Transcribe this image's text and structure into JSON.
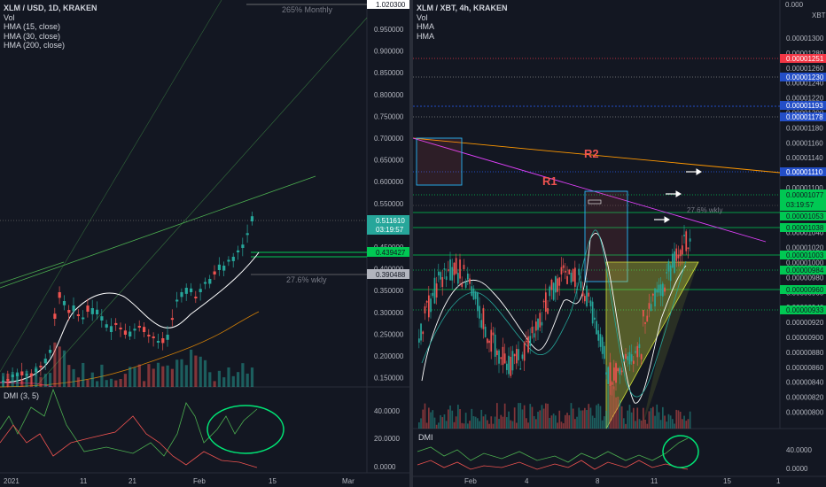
{
  "left": {
    "title": "XLM / USD, 1D, KRAKEN",
    "legend": [
      "Vol",
      "HMA (15, close)",
      "HMA (30, close)",
      "HMA (200, close)"
    ],
    "price_axis": [
      "0.950000",
      "0.900000",
      "0.850000",
      "0.800000",
      "0.750000",
      "0.700000",
      "0.650000",
      "0.600000",
      "0.550000",
      "0.500000",
      "0.450000",
      "0.400000",
      "0.350000",
      "0.300000",
      "0.250000",
      "0.200000",
      "0.150000"
    ],
    "tags": {
      "top": "1.020300",
      "last": "0.511610",
      "countdown": "03:19:57",
      "green": "0.439427",
      "grey": "0.390488"
    },
    "annotations": {
      "monthly": "265% Monthly",
      "weekly": "27.6% wkly"
    },
    "dmi": {
      "label": "DMI (3, 5)",
      "axis": [
        "40.0000",
        "20.0000",
        "0.0000"
      ]
    },
    "time_axis": [
      "2021",
      "11",
      "21",
      "Feb",
      "15",
      "Mar"
    ]
  },
  "right": {
    "title": "XLM / XBT, 4h, KRAKEN",
    "legend": [
      "Vol",
      "HMA",
      "HMA"
    ],
    "currency": "XBT",
    "price_axis": [
      "0.00001300",
      "0.00001280",
      "0.00001260",
      "0.00001240",
      "0.00001220",
      "0.00001200",
      "0.00001180",
      "0.00001160",
      "0.00001140",
      "0.00001120",
      "0.00001100",
      "0.00001080",
      "0.00001060",
      "0.00001040",
      "0.00001020",
      "0.00001000",
      "0.00000980",
      "0.00000960",
      "0.00000940",
      "0.00000920",
      "0.00000900",
      "0.00000880",
      "0.00000860",
      "0.00000840",
      "0.00000820",
      "0.00000800"
    ],
    "top_axis": "0.000",
    "tags": {
      "red": "0.00001251",
      "blue1": "0.00001230",
      "blue2": "0.00001193",
      "blue3": "0.00001178",
      "blue4": "0.00001110",
      "last": "0.00001077",
      "countdown": "03:19:57",
      "g1": "0.00001053",
      "g2": "0.00001038",
      "g3": "0.00001003",
      "g4": "0.00000984",
      "g5": "0.00000960",
      "g6": "0.00000933"
    },
    "annotations": {
      "r1": "R1",
      "r2": "R2",
      "weekly": "27.6% wkly"
    },
    "dmi": {
      "label": "DMI",
      "axis": [
        "40.0000",
        "0.0000"
      ]
    },
    "time_axis": [
      "Feb",
      "4",
      "8",
      "11",
      "15",
      "1"
    ]
  },
  "colors": {
    "bg": "#131722",
    "up": "#26a69a",
    "down": "#ef5350",
    "tag_green": "#00c853",
    "tag_blue": "#2962ff",
    "tag_red": "#f23645",
    "circle": "#00e676"
  }
}
